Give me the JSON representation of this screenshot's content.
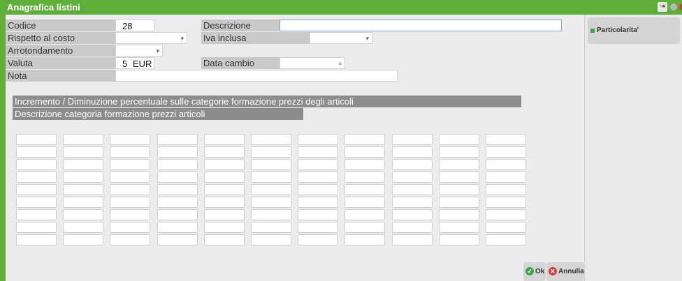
{
  "window": {
    "title": "Anagrafica listini",
    "pin_glyph": "⇥"
  },
  "form": {
    "codice_label": "Codice",
    "codice_value": "28",
    "descrizione_label": "Descrizione",
    "descrizione_value": "",
    "rispetto_label": "Rispetto al costo",
    "rispetto_value": "",
    "iva_label": "Iva inclusa",
    "iva_value": "",
    "arrotondamento_label": "Arrotondamento",
    "arrotondamento_value": "",
    "valuta_label": "Valuta",
    "valuta_code": "5",
    "valuta_currency": "EUR",
    "data_cambio_label": "Data cambio",
    "data_cambio_value": "",
    "nota_label": "Nota",
    "nota_value": ""
  },
  "section": {
    "incremento_title": "Incremento / Diminuzione percentuale sulle categorie formazione prezzi degli articoli",
    "descrizione_categoria": "Descrizione categoria formazione prezzi articoli"
  },
  "grid": {
    "rows": 9,
    "cols": 11
  },
  "sidebar": {
    "particolarita_label": "Particolarita'"
  },
  "buttons": {
    "ok_label": "Ok",
    "annulla_label": "Annulla"
  },
  "colors": {
    "accent": "#5fae3a",
    "ok": "#39a84b",
    "cancel": "#d63b3b"
  }
}
